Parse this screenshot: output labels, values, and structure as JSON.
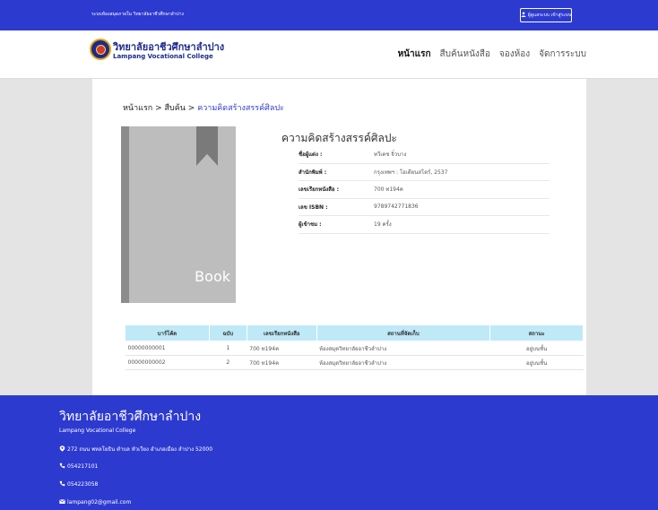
{
  "topbar": {
    "system_name": "ระบบห้องสมุดภายใน วิทยาลัยอาชีวศึกษาลำปาง",
    "login_label": "ผู้ดูแลระบบ เข้าสู่ระบบ",
    "login_icon": "user-icon"
  },
  "header": {
    "brand_th": "วิทยาลัยอาชีวศึกษาลำปาง",
    "brand_en": "Lampang Vocational College",
    "nav": [
      "หน้าแรก",
      "สืบค้นหนังสือ",
      "จองห้อง",
      "จัดการระบบ"
    ]
  },
  "breadcrumb": {
    "home": "หน้าแรก",
    "sep": ">",
    "search": "สืบค้น",
    "current": "ความคิดสร้างสรรค์ศิลปะ"
  },
  "book": {
    "cover_label": "Book",
    "title": "ความคิดสร้างสรรค์ศิลปะ",
    "details": [
      {
        "label": "ชื่อผู้แต่ง :",
        "value": "ทวีเดช จิ๋วบาง"
      },
      {
        "label": "สำนักพิมพ์ :",
        "value": "กรุงเทพฯ : โอเดียนสโตร์, 2537"
      },
      {
        "label": "เลขเรียกหนังสือ :",
        "value": "700 ท194ค"
      },
      {
        "label": "เลข ISBN :",
        "value": "9789742771836"
      },
      {
        "label": "ผู้เข้าชม :",
        "value": "19 ครั้ง"
      }
    ]
  },
  "copies": {
    "headers": [
      "บาร์โค้ด",
      "ฉบับ",
      "เลขเรียกหนังสือ",
      "สถานที่จัดเก็บ",
      "สถานะ"
    ],
    "rows": [
      [
        "00000000001",
        "1",
        "700 ท194ค",
        "ห้องสมุดวิทยาลัยอาชีวลำปาง",
        "อยู่บนชั้น"
      ],
      [
        "00000000002",
        "2",
        "700 ท194ค",
        "ห้องสมุดวิทยาลัยอาชีวลำปาง",
        "อยู่บนชั้น"
      ]
    ]
  },
  "footer": {
    "title": "วิทยาลัยอาชีวศึกษาลำปาง",
    "subtitle": "Lampang Vocational College",
    "address": "272 ถนน พหลโยธิน ตำบล หัวเวียง อำเภอเมือง ลำปาง 52000",
    "phone1": "054217101",
    "phone2": "054223058",
    "email": "lampang02@gmail.com"
  },
  "colors": {
    "primary": "#2d3ad0",
    "table_header": "#bfe9f7",
    "brand_text": "#1c2a8f"
  }
}
